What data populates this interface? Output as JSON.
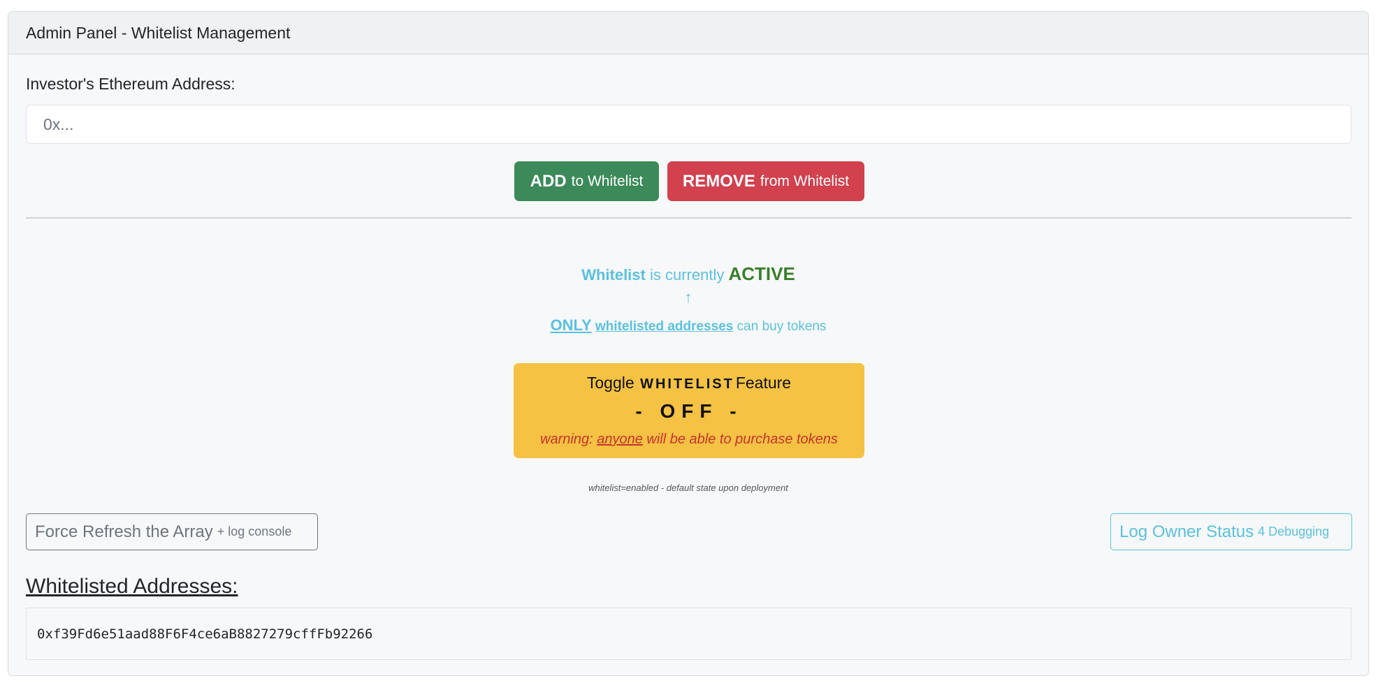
{
  "panel": {
    "title": "Admin Panel - Whitelist Management"
  },
  "form": {
    "address_label": "Investor's Ethereum Address:",
    "address_placeholder": "0x...",
    "address_value": ""
  },
  "buttons": {
    "add_strong": "ADD",
    "add_rest": "to Whitelist",
    "remove_strong": "REMOVE",
    "remove_rest": "from Whitelist"
  },
  "status": {
    "whitelist_word": "Whitelist",
    "is_currently": "is currently",
    "state": "ACTIVE",
    "arrow": "↑",
    "only": "ONLY",
    "whitelisted_addresses": "whitelisted addresses",
    "can_buy": "can buy tokens"
  },
  "toggle": {
    "prefix": "Toggle",
    "feature_word": "WHITELIST",
    "suffix": "Feature",
    "action": "- OFF -",
    "warning_prefix": "warning:",
    "warning_anyone": "anyone",
    "warning_rest": "will be able to purchase tokens"
  },
  "note": "whitelist=enabled - default state upon deployment",
  "actions": {
    "refresh_label": "Force Refresh the Array",
    "refresh_small": "+ log console",
    "log_label": "Log Owner Status",
    "log_small": "4 Debugging"
  },
  "whitelist": {
    "title": "Whitelisted Addresses:",
    "addresses": [
      "0xf39Fd6e51aad88F6F4ce6aB8827279cffFb92266"
    ]
  },
  "colors": {
    "success": "#3c8a5a",
    "danger": "#d1414e",
    "info": "#5bc0de",
    "warning": "#f5c244",
    "active_text": "#3a7d2c"
  }
}
